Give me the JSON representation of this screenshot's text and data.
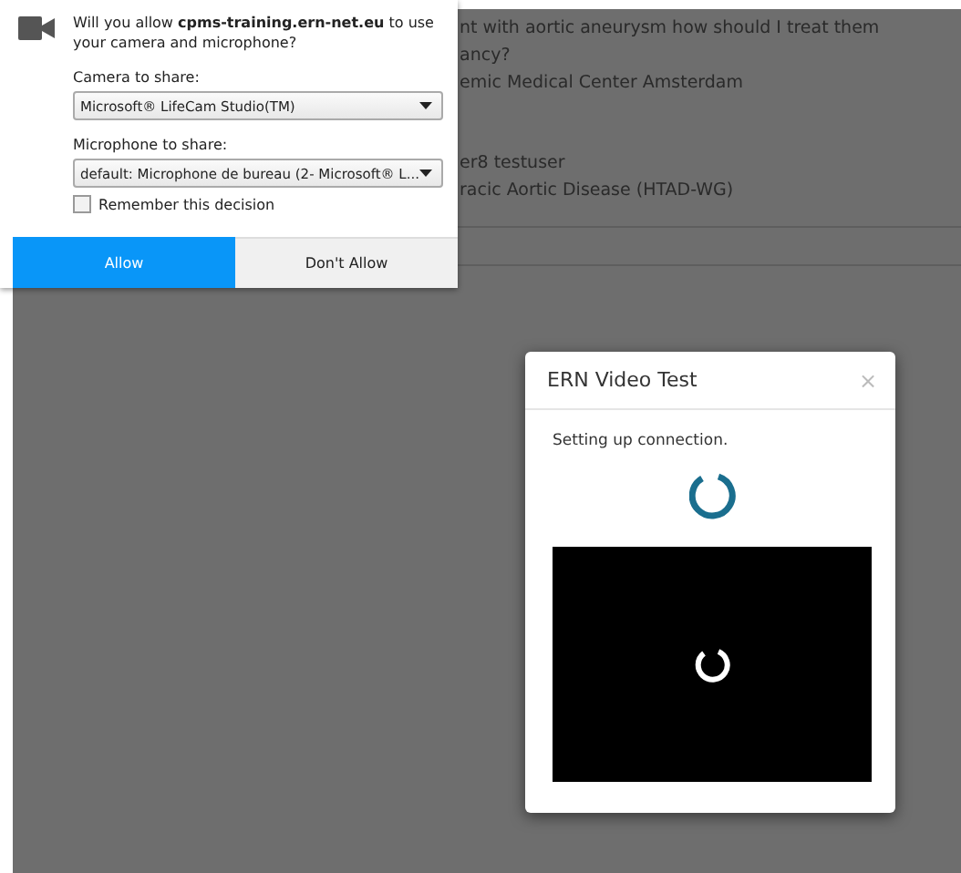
{
  "background_page": {
    "lines": [
      "nt with aortic aneurysm how should I treat them",
      "ancy?",
      "emic Medical Center Amsterdam",
      "er8 testuser",
      "racic Aortic Disease (HTAD-WG)"
    ]
  },
  "permission_popup": {
    "message": "Will you allow **cpms-training.ern-net.eu** to use your camera and microphone?",
    "camera_label": "Camera to share:",
    "camera_value": "Microsoft® LifeCam Studio(TM)",
    "microphone_label": "Microphone to share:",
    "microphone_value": "default: Microphone de bureau (2- Microsoft® L...",
    "remember": {
      "label": "Remember this decision",
      "checked": false
    },
    "buttons": [
      {
        "label": "Allow",
        "selected": true
      },
      {
        "label": "Don't Allow",
        "selected": false
      }
    ]
  },
  "dialog": {
    "title": "ERN Video Test",
    "close": "×",
    "status": "Setting up connection."
  }
}
